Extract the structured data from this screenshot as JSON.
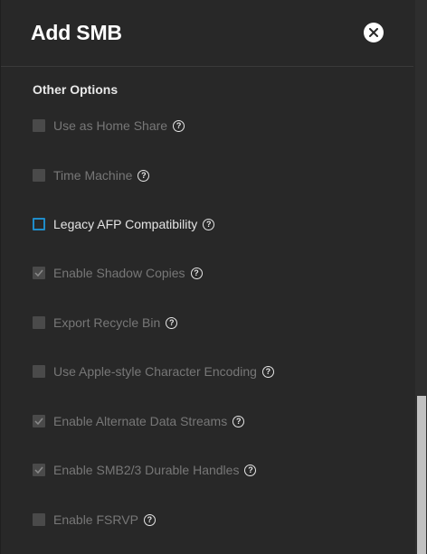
{
  "dialog": {
    "title": "Add SMB"
  },
  "section": {
    "title": "Other Options"
  },
  "help_glyph": "?",
  "options": [
    {
      "label": "Use as Home Share",
      "checked": false,
      "disabled": true
    },
    {
      "label": "Time Machine",
      "checked": false,
      "disabled": true
    },
    {
      "label": "Legacy AFP Compatibility",
      "checked": false,
      "disabled": false
    },
    {
      "label": "Enable Shadow Copies",
      "checked": true,
      "disabled": true
    },
    {
      "label": "Export Recycle Bin",
      "checked": false,
      "disabled": true
    },
    {
      "label": "Use Apple-style Character Encoding",
      "checked": false,
      "disabled": true
    },
    {
      "label": "Enable Alternate Data Streams",
      "checked": true,
      "disabled": true
    },
    {
      "label": "Enable SMB2/3 Durable Handles",
      "checked": true,
      "disabled": true
    },
    {
      "label": "Enable FSRVP",
      "checked": false,
      "disabled": true
    }
  ],
  "icons": {
    "close": "close-icon",
    "help": "help-circle-icon",
    "check": "check-icon"
  },
  "colors": {
    "background": "#282828",
    "accent": "#1f8cc9",
    "disabled_text": "#777777",
    "active_text": "#e4e4e4"
  }
}
